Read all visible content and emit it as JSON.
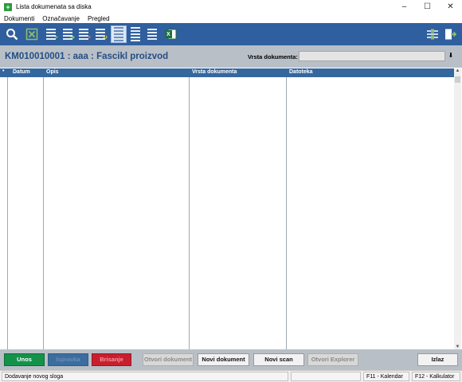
{
  "window": {
    "title": "Lista dokumenata sa diska",
    "app_icon": "+",
    "min": "–",
    "max": "☐",
    "close": "✕"
  },
  "menu": [
    "Dokumenti",
    "Označavanje",
    "Pregled"
  ],
  "toolbar": {
    "icons": [
      "search-icon",
      "cancel-selection-icon",
      "list-add-icon",
      "list-forward-icon",
      "list-delete-icon",
      "list-refresh-icon",
      "view-list-icon",
      "view-details-icon",
      "view-compact-icon",
      "excel-export-icon",
      "settings-icon",
      "exit-icon"
    ],
    "badges": {
      "excel": "X"
    },
    "accent": "#2f5f9e"
  },
  "header": {
    "title": "KM010010001 : aaa : Fascikl proizvod",
    "vrsta_label": "Vrsta dokumenta:",
    "vrsta_value": "",
    "vrsta_dropdown_glyph": "⬇"
  },
  "grid": {
    "marker": "•",
    "columns": [
      "Datum",
      "Opis",
      "Vrsta dokumenta",
      "Datoteka"
    ],
    "rows": []
  },
  "scrollbar": {
    "up": "▲",
    "down": "▼"
  },
  "buttons": {
    "unos": "Unos",
    "ispravka": "Ispravka",
    "brisanje": "Brisanje",
    "otvori_dokument": "Otvori dokument",
    "novi_dokument": "Novi dokument",
    "novi_scan": "Novi scan",
    "otvori_explorer": "Otvori Explorer",
    "izlaz": "Izlaz"
  },
  "status": {
    "message": "Dodavanje novog sloga",
    "f11": "F11 - Kalendar",
    "f12": "F12 - Kalkulator"
  }
}
